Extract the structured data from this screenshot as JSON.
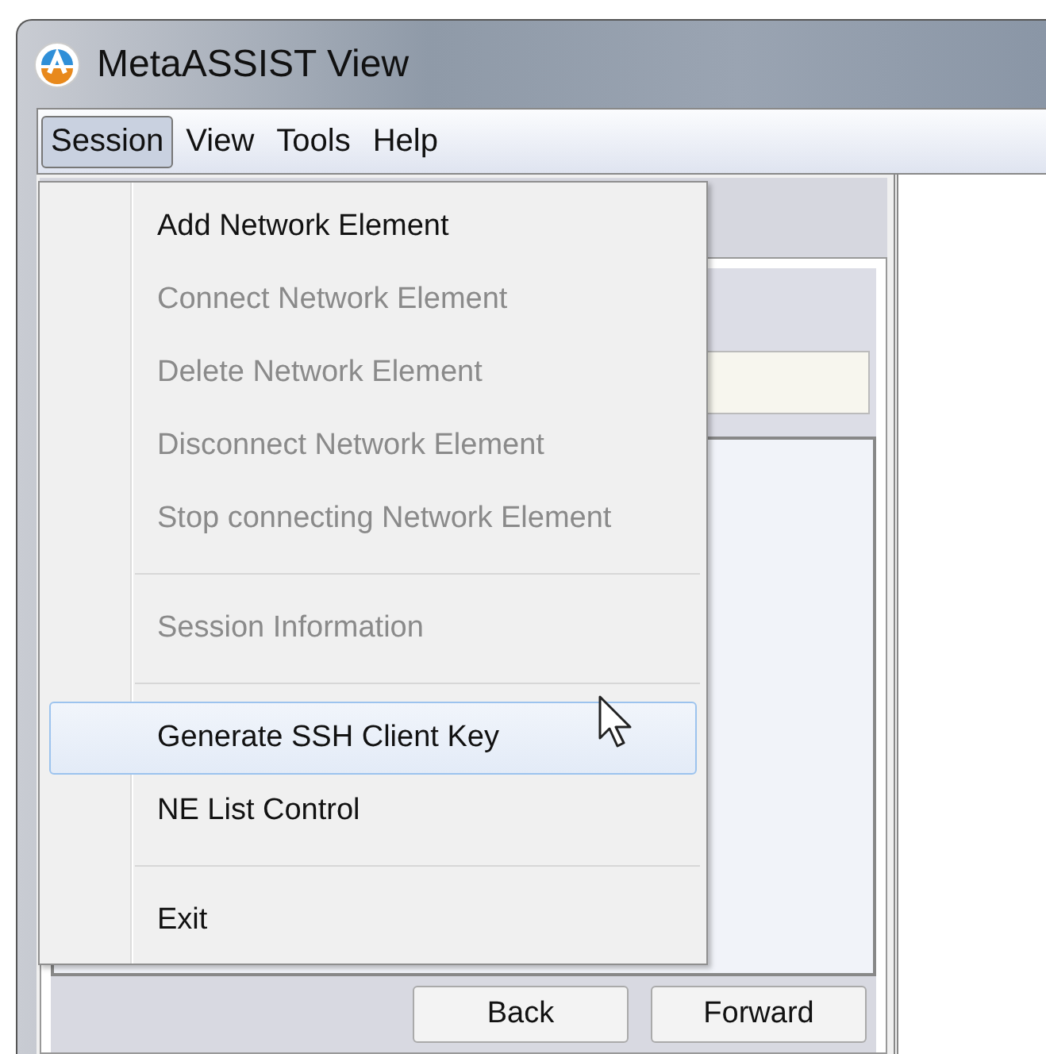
{
  "window": {
    "title": "MetaASSIST View"
  },
  "menubar": [
    {
      "label": "Session",
      "selected": true
    },
    {
      "label": "View",
      "selected": false
    },
    {
      "label": "Tools",
      "selected": false
    },
    {
      "label": "Help",
      "selected": false
    }
  ],
  "menu": [
    {
      "kind": "item",
      "label": "Add Network Element",
      "disabled": false,
      "selected": false
    },
    {
      "kind": "item",
      "label": "Connect Network Element",
      "disabled": true,
      "selected": false
    },
    {
      "kind": "item",
      "label": "Delete Network Element",
      "disabled": true,
      "selected": false
    },
    {
      "kind": "item",
      "label": "Disconnect Network Element",
      "disabled": true,
      "selected": false
    },
    {
      "kind": "item",
      "label": "Stop connecting Network Element",
      "disabled": true,
      "selected": false
    },
    {
      "kind": "separator"
    },
    {
      "kind": "item",
      "label": "Session Information",
      "disabled": true,
      "selected": false
    },
    {
      "kind": "separator"
    },
    {
      "kind": "item",
      "label": "Generate SSH Client Key",
      "disabled": false,
      "selected": true
    },
    {
      "kind": "item",
      "label": "NE List Control",
      "disabled": false,
      "selected": false
    },
    {
      "kind": "separator"
    },
    {
      "kind": "item",
      "label": "Exit",
      "disabled": false,
      "selected": false
    }
  ],
  "buttons": [
    "Back",
    "Forward"
  ]
}
